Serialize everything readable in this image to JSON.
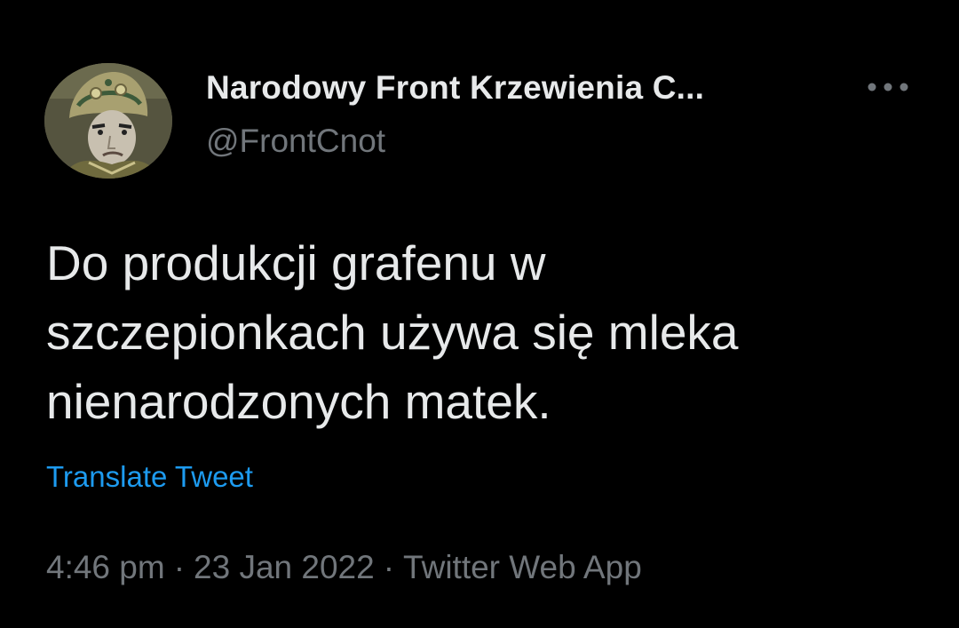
{
  "author": {
    "display_name": "Narodowy Front Krzewienia C...",
    "handle": "@FrontCnot",
    "avatar_icon": "profile-photo"
  },
  "more_icon": "ellipsis-icon",
  "tweet": {
    "text_lines": [
      "Do produkcji grafenu w",
      "szczepionkach używa się mleka",
      "nienarodzonych matek."
    ],
    "translate_label": "Translate Tweet"
  },
  "meta": {
    "time": "4:46 pm",
    "separator": "·",
    "date": "23 Jan 2022",
    "source": "Twitter Web App"
  },
  "colors": {
    "background": "#000000",
    "text": "#e7e9ea",
    "secondary": "#71767b",
    "link": "#1d9bf0"
  }
}
